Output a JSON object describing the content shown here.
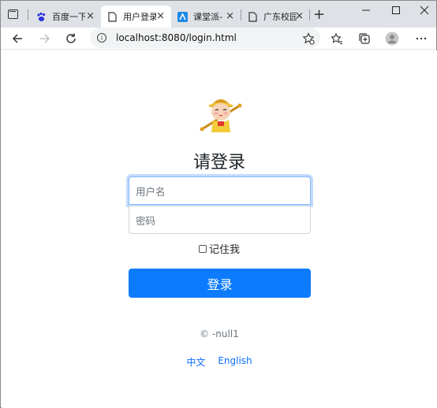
{
  "browser": {
    "tabs": [
      {
        "title": "百度一下",
        "favicon": "baidu-paw-icon",
        "active": false
      },
      {
        "title": "用户登录",
        "favicon": "page-icon",
        "active": true
      },
      {
        "title": "课堂派-",
        "favicon": "ketangpai-icon",
        "active": false
      },
      {
        "title": "广东校园",
        "favicon": "page-icon",
        "active": false
      }
    ],
    "close_glyph": "×",
    "new_tab_glyph": "+",
    "address": "localhost:8080/login.html"
  },
  "login": {
    "heading": "请登录",
    "username_placeholder": "用户名",
    "password_placeholder": "密码",
    "remember_label": "记住我",
    "submit_label": "登录",
    "copyright": "© -null1",
    "languages": [
      "中文",
      "English"
    ]
  },
  "colors": {
    "primary": "#0d7bfd",
    "link": "#0d6efd",
    "focus_border": "#86b7fe"
  }
}
